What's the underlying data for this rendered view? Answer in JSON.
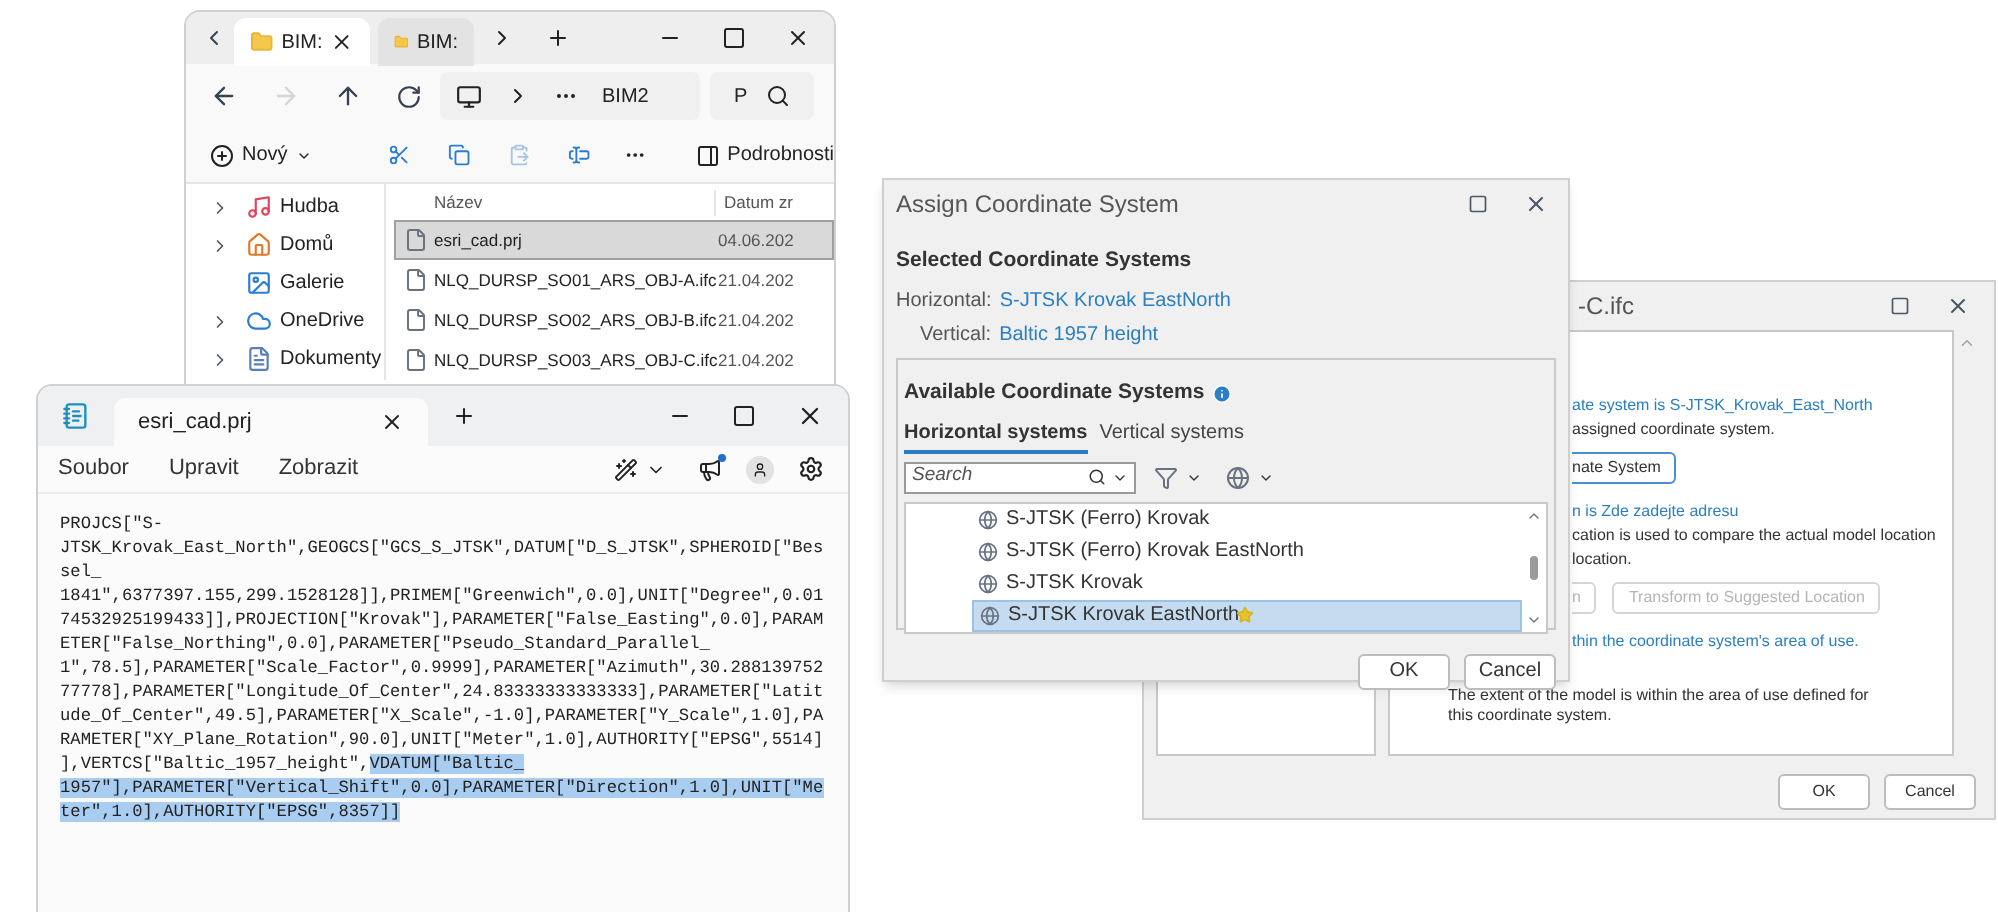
{
  "explorer": {
    "tabs": [
      {
        "label": "BIM:",
        "selected": true
      },
      {
        "label": "BIM:",
        "selected": false
      }
    ],
    "address": "BIM2",
    "search": "P",
    "new_label": "Nový",
    "details_label": "Podrobnosti",
    "nav": [
      {
        "label": "Hudba",
        "expandable": true,
        "kind": "music"
      },
      {
        "label": "Domů",
        "expandable": true,
        "kind": "home"
      },
      {
        "label": "Galerie",
        "expandable": false,
        "kind": "gallery"
      },
      {
        "label": "OneDrive",
        "expandable": true,
        "kind": "cloud"
      },
      {
        "label": "Dokumenty",
        "expandable": true,
        "kind": "documents"
      }
    ],
    "columns": [
      "Název",
      "Datum zr"
    ],
    "files": [
      {
        "name": "esri_cad.prj",
        "date": "04.06.202",
        "selected": true
      },
      {
        "name": "NLQ_DURSP_SO01_ARS_OBJ-A.ifc",
        "date": "21.04.202",
        "selected": false
      },
      {
        "name": "NLQ_DURSP_SO02_ARS_OBJ-B.ifc",
        "date": "21.04.202",
        "selected": false
      },
      {
        "name": "NLQ_DURSP_SO03_ARS_OBJ-C.ifc",
        "date": "21.04.202",
        "selected": false
      }
    ]
  },
  "notepad": {
    "tab": "esri_cad.prj",
    "menu": [
      "Soubor",
      "Upravit",
      "Zobrazit"
    ],
    "lines": [
      [
        {
          "text": "PROJCS[\"S-",
          "selected": false
        }
      ],
      [
        {
          "text": "JTSK_Krovak_East_North\",GEOGCS[\"GCS_S_JTSK\",DATUM[\"D_S_JTSK\",SPHEROID[\"Bes",
          "selected": false
        }
      ],
      [
        {
          "text": "sel_",
          "selected": false
        }
      ],
      [
        {
          "text": "1841\",6377397.155,299.1528128]],PRIMEM[\"Greenwich\",0.0],UNIT[\"Degree\",0.01",
          "selected": false
        }
      ],
      [
        {
          "text": "74532925199433]],PROJECTION[\"Krovak\"],PARAMETER[\"False_Easting\",0.0],PARAM",
          "selected": false
        }
      ],
      [
        {
          "text": "ETER[\"False_Northing\",0.0],PARAMETER[\"Pseudo_Standard_Parallel_",
          "selected": false
        }
      ],
      [
        {
          "text": "1\",78.5],PARAMETER[\"Scale_Factor\",0.9999],PARAMETER[\"Azimuth\",30.288139752",
          "selected": false
        }
      ],
      [
        {
          "text": "77778],PARAMETER[\"Longitude_Of_Center\",24.83333333333333],PARAMETER[\"Latit",
          "selected": false
        }
      ],
      [
        {
          "text": "ude_Of_Center\",49.5],PARAMETER[\"X_Scale\",-1.0],PARAMETER[\"Y_Scale\",1.0],PA",
          "selected": false
        }
      ],
      [
        {
          "text": "RAMETER[\"XY_Plane_Rotation\",90.0],UNIT[\"Meter\",1.0],AUTHORITY[\"EPSG\",5514]",
          "selected": false
        }
      ],
      [
        {
          "text": "],VERTCS[\"Baltic_1957_height\",",
          "selected": false
        },
        {
          "text": "VDATUM[\"Baltic_",
          "selected": true
        }
      ],
      [
        {
          "text": "1957\"],PARAMETER[\"Vertical_Shift\",0.0],PARAMETER[\"Direction\",1.0],UNIT[\"Me",
          "selected": true
        }
      ],
      [
        {
          "text": "ter\",1.0],AUTHORITY[\"EPSG\",8357]]",
          "selected": true
        }
      ]
    ]
  },
  "location_dialog": {
    "title": "-C.ifc",
    "sections": [
      {
        "kind": "link",
        "text": "ate system is S-JTSK_Krovak_East_North"
      },
      {
        "kind": "text",
        "text": "assigned coordinate system."
      },
      {
        "kind": "buttons",
        "buttons": [
          {
            "label": "nate System",
            "disabled": false
          }
        ]
      },
      {
        "kind": "link",
        "text": "n is Zde zadejte adresu"
      },
      {
        "kind": "text",
        "text": "cation is used to compare the actual model location"
      },
      {
        "kind": "text",
        "text": "location."
      },
      {
        "kind": "buttons",
        "buttons": [
          {
            "label": "n",
            "disabled": true
          },
          {
            "label": "Transform to Suggested Location",
            "disabled": true
          }
        ]
      },
      {
        "kind": "link",
        "text": "thin the coordinate system's area of use."
      },
      {
        "kind": "note",
        "text": "The extent of the model is within the area of use defined for this coordinate system."
      }
    ],
    "buttons": [
      "OK",
      "Cancel"
    ]
  },
  "assign_dialog": {
    "title": "Assign Coordinate System",
    "selected_heading": "Selected Coordinate Systems",
    "horizontal": {
      "label": "Horizontal:",
      "value": "S-JTSK Krovak EastNorth"
    },
    "vertical": {
      "label": "Vertical:",
      "value": "Baltic 1957 height"
    },
    "available_heading": "Available Coordinate Systems",
    "tabs": [
      {
        "label": "Horizontal systems",
        "selected": true
      },
      {
        "label": "Vertical systems",
        "selected": false
      }
    ],
    "search": {
      "placeholder": "Search"
    },
    "systems": [
      {
        "name": "S-JTSK (Ferro) Krovak",
        "selected": false,
        "favorite": false
      },
      {
        "name": "S-JTSK (Ferro) Krovak EastNorth",
        "selected": false,
        "favorite": false
      },
      {
        "name": "S-JTSK Krovak",
        "selected": false,
        "favorite": false
      },
      {
        "name": "S-JTSK Krovak EastNorth",
        "selected": true,
        "favorite": true
      }
    ],
    "buttons": [
      "OK",
      "Cancel"
    ]
  }
}
